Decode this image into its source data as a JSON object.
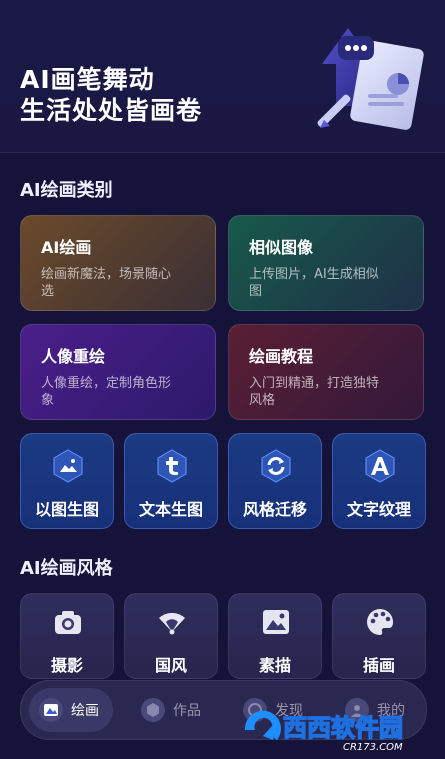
{
  "hero": {
    "line1": "AI画笔舞动",
    "line2": "生活处处皆画卷"
  },
  "categories_title": "AI绘画类别",
  "cards": [
    {
      "title": "AI绘画",
      "desc": "绘画新魔法，场景随心选"
    },
    {
      "title": "相似图像",
      "desc": "上传图片，AI生成相似图"
    },
    {
      "title": "人像重绘",
      "desc": "人像重绘，定制角色形象"
    },
    {
      "title": "绘画教程",
      "desc": "入门到精通，打造独特风格"
    }
  ],
  "tools": [
    {
      "label": "以图生图",
      "icon": "image-icon"
    },
    {
      "label": "文本生图",
      "icon": "text-t-icon"
    },
    {
      "label": "风格迁移",
      "icon": "refresh-icon"
    },
    {
      "label": "文字纹理",
      "icon": "letter-a-icon"
    }
  ],
  "styles_title": "AI绘画风格",
  "styles": [
    {
      "label": "摄影",
      "icon": "camera-icon"
    },
    {
      "label": "国风",
      "icon": "fan-icon"
    },
    {
      "label": "素描",
      "icon": "picture-icon"
    },
    {
      "label": "插画",
      "icon": "palette-icon"
    }
  ],
  "tabs": [
    {
      "label": "绘画",
      "active": true
    },
    {
      "label": "作品"
    },
    {
      "label": "发现"
    },
    {
      "label": "我的"
    }
  ],
  "watermark": {
    "text": "西西软件园",
    "sub": "CR173.COM"
  }
}
